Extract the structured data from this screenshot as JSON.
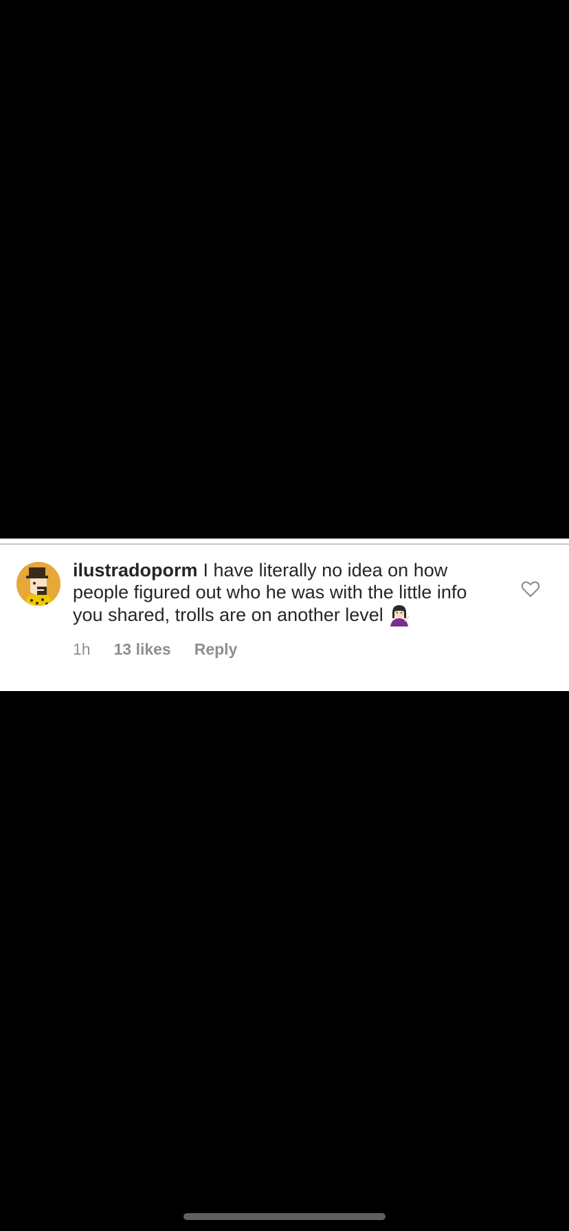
{
  "comment": {
    "username": "ilustradoporm",
    "text": "I have literally no idea on how people figured out who he was with the little info you shared, trolls are on another level",
    "emoji": "woman-shrugging-emoji",
    "time": "1h",
    "likes": "13 likes",
    "reply_label": "Reply",
    "avatar_icon": "illustrated-avatar",
    "like_icon": "heart-outline-icon"
  },
  "colors": {
    "background": "#000000",
    "card": "#ffffff",
    "text": "#262626",
    "muted": "#8e8e8e",
    "avatar_bg": "#e7a83a"
  }
}
